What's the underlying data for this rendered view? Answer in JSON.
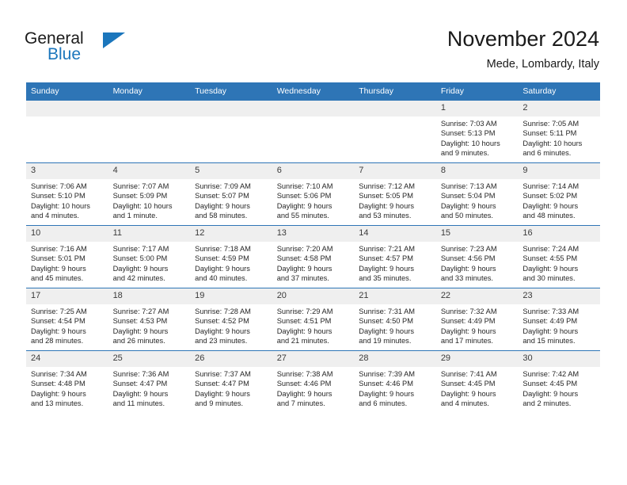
{
  "logo": {
    "word_one": "General",
    "word_two": "Blue",
    "triangle_color": "#1b76bc"
  },
  "header": {
    "title": "November 2024",
    "subtitle": "Mede, Lombardy, Italy"
  },
  "theme": {
    "header_blue": "#2e75b6",
    "daynum_gray": "#efefef",
    "text_dark": "#1a1a1a"
  },
  "weekday_headers": [
    "Sunday",
    "Monday",
    "Tuesday",
    "Wednesday",
    "Thursday",
    "Friday",
    "Saturday"
  ],
  "weeks": [
    [
      {
        "day": "",
        "empty": true,
        "sunrise": "",
        "sunset": "",
        "daylight_line1": "",
        "daylight_line2": ""
      },
      {
        "day": "",
        "empty": true,
        "sunrise": "",
        "sunset": "",
        "daylight_line1": "",
        "daylight_line2": ""
      },
      {
        "day": "",
        "empty": true,
        "sunrise": "",
        "sunset": "",
        "daylight_line1": "",
        "daylight_line2": ""
      },
      {
        "day": "",
        "empty": true,
        "sunrise": "",
        "sunset": "",
        "daylight_line1": "",
        "daylight_line2": ""
      },
      {
        "day": "",
        "empty": true,
        "sunrise": "",
        "sunset": "",
        "daylight_line1": "",
        "daylight_line2": ""
      },
      {
        "day": "1",
        "empty": false,
        "sunrise": "Sunrise: 7:03 AM",
        "sunset": "Sunset: 5:13 PM",
        "daylight_line1": "Daylight: 10 hours",
        "daylight_line2": "and 9 minutes."
      },
      {
        "day": "2",
        "empty": false,
        "sunrise": "Sunrise: 7:05 AM",
        "sunset": "Sunset: 5:11 PM",
        "daylight_line1": "Daylight: 10 hours",
        "daylight_line2": "and 6 minutes."
      }
    ],
    [
      {
        "day": "3",
        "empty": false,
        "sunrise": "Sunrise: 7:06 AM",
        "sunset": "Sunset: 5:10 PM",
        "daylight_line1": "Daylight: 10 hours",
        "daylight_line2": "and 4 minutes."
      },
      {
        "day": "4",
        "empty": false,
        "sunrise": "Sunrise: 7:07 AM",
        "sunset": "Sunset: 5:09 PM",
        "daylight_line1": "Daylight: 10 hours",
        "daylight_line2": "and 1 minute."
      },
      {
        "day": "5",
        "empty": false,
        "sunrise": "Sunrise: 7:09 AM",
        "sunset": "Sunset: 5:07 PM",
        "daylight_line1": "Daylight: 9 hours",
        "daylight_line2": "and 58 minutes."
      },
      {
        "day": "6",
        "empty": false,
        "sunrise": "Sunrise: 7:10 AM",
        "sunset": "Sunset: 5:06 PM",
        "daylight_line1": "Daylight: 9 hours",
        "daylight_line2": "and 55 minutes."
      },
      {
        "day": "7",
        "empty": false,
        "sunrise": "Sunrise: 7:12 AM",
        "sunset": "Sunset: 5:05 PM",
        "daylight_line1": "Daylight: 9 hours",
        "daylight_line2": "and 53 minutes."
      },
      {
        "day": "8",
        "empty": false,
        "sunrise": "Sunrise: 7:13 AM",
        "sunset": "Sunset: 5:04 PM",
        "daylight_line1": "Daylight: 9 hours",
        "daylight_line2": "and 50 minutes."
      },
      {
        "day": "9",
        "empty": false,
        "sunrise": "Sunrise: 7:14 AM",
        "sunset": "Sunset: 5:02 PM",
        "daylight_line1": "Daylight: 9 hours",
        "daylight_line2": "and 48 minutes."
      }
    ],
    [
      {
        "day": "10",
        "empty": false,
        "sunrise": "Sunrise: 7:16 AM",
        "sunset": "Sunset: 5:01 PM",
        "daylight_line1": "Daylight: 9 hours",
        "daylight_line2": "and 45 minutes."
      },
      {
        "day": "11",
        "empty": false,
        "sunrise": "Sunrise: 7:17 AM",
        "sunset": "Sunset: 5:00 PM",
        "daylight_line1": "Daylight: 9 hours",
        "daylight_line2": "and 42 minutes."
      },
      {
        "day": "12",
        "empty": false,
        "sunrise": "Sunrise: 7:18 AM",
        "sunset": "Sunset: 4:59 PM",
        "daylight_line1": "Daylight: 9 hours",
        "daylight_line2": "and 40 minutes."
      },
      {
        "day": "13",
        "empty": false,
        "sunrise": "Sunrise: 7:20 AM",
        "sunset": "Sunset: 4:58 PM",
        "daylight_line1": "Daylight: 9 hours",
        "daylight_line2": "and 37 minutes."
      },
      {
        "day": "14",
        "empty": false,
        "sunrise": "Sunrise: 7:21 AM",
        "sunset": "Sunset: 4:57 PM",
        "daylight_line1": "Daylight: 9 hours",
        "daylight_line2": "and 35 minutes."
      },
      {
        "day": "15",
        "empty": false,
        "sunrise": "Sunrise: 7:23 AM",
        "sunset": "Sunset: 4:56 PM",
        "daylight_line1": "Daylight: 9 hours",
        "daylight_line2": "and 33 minutes."
      },
      {
        "day": "16",
        "empty": false,
        "sunrise": "Sunrise: 7:24 AM",
        "sunset": "Sunset: 4:55 PM",
        "daylight_line1": "Daylight: 9 hours",
        "daylight_line2": "and 30 minutes."
      }
    ],
    [
      {
        "day": "17",
        "empty": false,
        "sunrise": "Sunrise: 7:25 AM",
        "sunset": "Sunset: 4:54 PM",
        "daylight_line1": "Daylight: 9 hours",
        "daylight_line2": "and 28 minutes."
      },
      {
        "day": "18",
        "empty": false,
        "sunrise": "Sunrise: 7:27 AM",
        "sunset": "Sunset: 4:53 PM",
        "daylight_line1": "Daylight: 9 hours",
        "daylight_line2": "and 26 minutes."
      },
      {
        "day": "19",
        "empty": false,
        "sunrise": "Sunrise: 7:28 AM",
        "sunset": "Sunset: 4:52 PM",
        "daylight_line1": "Daylight: 9 hours",
        "daylight_line2": "and 23 minutes."
      },
      {
        "day": "20",
        "empty": false,
        "sunrise": "Sunrise: 7:29 AM",
        "sunset": "Sunset: 4:51 PM",
        "daylight_line1": "Daylight: 9 hours",
        "daylight_line2": "and 21 minutes."
      },
      {
        "day": "21",
        "empty": false,
        "sunrise": "Sunrise: 7:31 AM",
        "sunset": "Sunset: 4:50 PM",
        "daylight_line1": "Daylight: 9 hours",
        "daylight_line2": "and 19 minutes."
      },
      {
        "day": "22",
        "empty": false,
        "sunrise": "Sunrise: 7:32 AM",
        "sunset": "Sunset: 4:49 PM",
        "daylight_line1": "Daylight: 9 hours",
        "daylight_line2": "and 17 minutes."
      },
      {
        "day": "23",
        "empty": false,
        "sunrise": "Sunrise: 7:33 AM",
        "sunset": "Sunset: 4:49 PM",
        "daylight_line1": "Daylight: 9 hours",
        "daylight_line2": "and 15 minutes."
      }
    ],
    [
      {
        "day": "24",
        "empty": false,
        "sunrise": "Sunrise: 7:34 AM",
        "sunset": "Sunset: 4:48 PM",
        "daylight_line1": "Daylight: 9 hours",
        "daylight_line2": "and 13 minutes."
      },
      {
        "day": "25",
        "empty": false,
        "sunrise": "Sunrise: 7:36 AM",
        "sunset": "Sunset: 4:47 PM",
        "daylight_line1": "Daylight: 9 hours",
        "daylight_line2": "and 11 minutes."
      },
      {
        "day": "26",
        "empty": false,
        "sunrise": "Sunrise: 7:37 AM",
        "sunset": "Sunset: 4:47 PM",
        "daylight_line1": "Daylight: 9 hours",
        "daylight_line2": "and 9 minutes."
      },
      {
        "day": "27",
        "empty": false,
        "sunrise": "Sunrise: 7:38 AM",
        "sunset": "Sunset: 4:46 PM",
        "daylight_line1": "Daylight: 9 hours",
        "daylight_line2": "and 7 minutes."
      },
      {
        "day": "28",
        "empty": false,
        "sunrise": "Sunrise: 7:39 AM",
        "sunset": "Sunset: 4:46 PM",
        "daylight_line1": "Daylight: 9 hours",
        "daylight_line2": "and 6 minutes."
      },
      {
        "day": "29",
        "empty": false,
        "sunrise": "Sunrise: 7:41 AM",
        "sunset": "Sunset: 4:45 PM",
        "daylight_line1": "Daylight: 9 hours",
        "daylight_line2": "and 4 minutes."
      },
      {
        "day": "30",
        "empty": false,
        "sunrise": "Sunrise: 7:42 AM",
        "sunset": "Sunset: 4:45 PM",
        "daylight_line1": "Daylight: 9 hours",
        "daylight_line2": "and 2 minutes."
      }
    ]
  ]
}
